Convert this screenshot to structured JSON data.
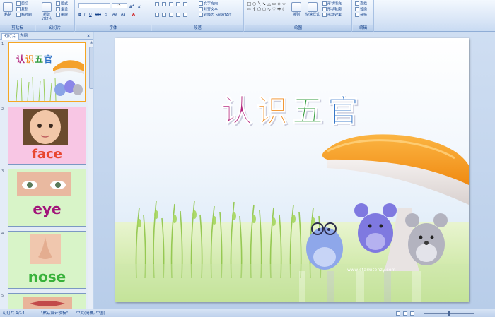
{
  "ribbon": {
    "groups": [
      {
        "id": "clipboard",
        "label": "剪贴板"
      },
      {
        "id": "slides",
        "label": "幻灯片"
      },
      {
        "id": "font",
        "label": "字体"
      },
      {
        "id": "paragraph",
        "label": "段落"
      },
      {
        "id": "drawing",
        "label": "绘图"
      },
      {
        "id": "editing",
        "label": "编辑"
      }
    ],
    "clipboard": {
      "paste": "粘贴",
      "cut": "剪切",
      "copy": "复制",
      "format_painter": "格式刷"
    },
    "slides": {
      "new_slide": "新建",
      "new_slide_2": "幻灯片",
      "layout": "版式",
      "reset": "重设",
      "delete": "删除"
    },
    "font": {
      "font_name": "",
      "font_size": "115"
    },
    "paragraph": {
      "text_direction": "文字方向",
      "align_text": "对齐文本",
      "smartart": "转换为 SmartArt"
    },
    "drawing": {
      "arrange": "排列",
      "quick_styles": "快速样式",
      "shape_fill": "形状填充",
      "shape_outline": "形状轮廓",
      "shape_effects": "形状效果"
    },
    "editing": {
      "find": "查找",
      "replace": "替换",
      "select": "选择"
    }
  },
  "panel": {
    "tabs": [
      "幻灯片",
      "大纲"
    ],
    "close": "×",
    "slides": [
      {
        "num": "1",
        "title": "认识五官"
      },
      {
        "num": "2",
        "word": "face",
        "word_color": "#e8462f",
        "bg": "#f8c6e4"
      },
      {
        "num": "3",
        "word": "eye",
        "word_color": "#a2157a",
        "bg": "#d8f4c8"
      },
      {
        "num": "4",
        "word": "nose",
        "word_color": "#38b13a",
        "bg": "#d8f4c8"
      },
      {
        "num": "5"
      }
    ]
  },
  "slide": {
    "title_chars": [
      {
        "char": "认",
        "color": "#b3267e"
      },
      {
        "char": "识",
        "color": "#f08a1c"
      },
      {
        "char": "五",
        "color": "#2f9b3b"
      },
      {
        "char": "官",
        "color": "#2e72c7"
      }
    ],
    "watermark": "www.starkitenzy.com"
  },
  "status": {
    "slide_info": "幻灯片 1/14",
    "theme": "\"默认设计模板\"",
    "language": "中文(简体, 中国)"
  }
}
